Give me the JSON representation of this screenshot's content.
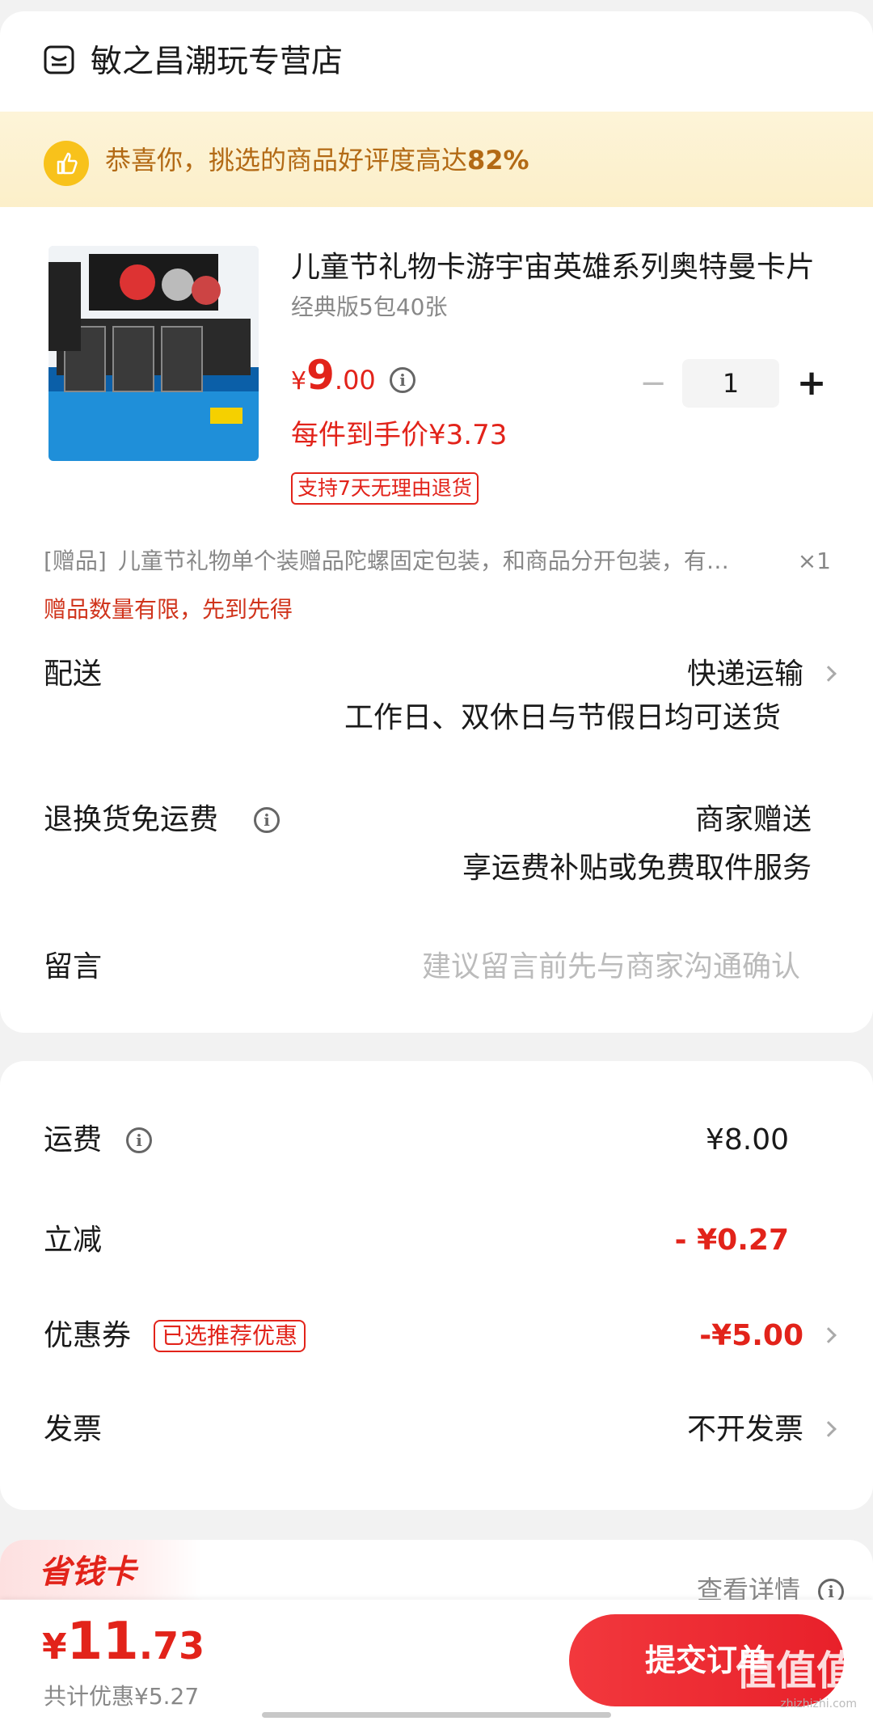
{
  "store": {
    "name": "敏之昌潮玩专营店"
  },
  "banner": {
    "text": "恭喜你，挑选的商品好评度高达",
    "highlight": "82%"
  },
  "product": {
    "title": "儿童节礼物卡游宇宙英雄系列奥特曼卡片",
    "spec": "经典版5包40张",
    "price_currency": "¥",
    "price_int": "9",
    "price_dec": ".00",
    "unit_price": "每件到手价¥3.73",
    "return_tag": "支持7天无理由退货",
    "quantity": "1",
    "minus": "−",
    "plus": "+"
  },
  "gift": {
    "label": "[赠品]",
    "text": "儿童节礼物单个装赠品陀螺固定包装，和商品分开包装，有…",
    "qty": "×1",
    "limit": "赠品数量有限，先到先得"
  },
  "delivery": {
    "label": "配送",
    "value": "快递运输",
    "sub": "工作日、双休日与节假日均可送货"
  },
  "return_shipping": {
    "label": "退换货免运费",
    "value": "商家赠送",
    "sub": "享运费补贴或免费取件服务"
  },
  "message": {
    "label": "留言",
    "placeholder": "建议留言前先与商家沟通确认"
  },
  "fees": {
    "shipping_label": "运费",
    "shipping_value": "¥8.00",
    "discount_label": "立减",
    "discount_value": "- ¥0.27",
    "coupon_label": "优惠券",
    "coupon_tag": "已选推荐优惠",
    "coupon_value": "-¥5.00",
    "invoice_label": "发票",
    "invoice_value": "不开发票"
  },
  "savings_card": {
    "title": "省钱卡",
    "detail": "查看详情"
  },
  "bottom": {
    "currency": "¥",
    "total_int": "11",
    "total_dec": ".73",
    "saved": "共计优惠¥5.27",
    "submit": "提交订单",
    "watermark": "值值值",
    "watermark_sub": "zhizhizhi.com"
  },
  "colors": {
    "accent": "#e2231a",
    "banner_text": "#b36a15",
    "banner_bg": "#fdf4d8",
    "thumb_icon": "#f8c21b"
  },
  "icons": [
    "store-icon",
    "thumbs-up-icon",
    "info-icon",
    "chevron-right-icon"
  ]
}
